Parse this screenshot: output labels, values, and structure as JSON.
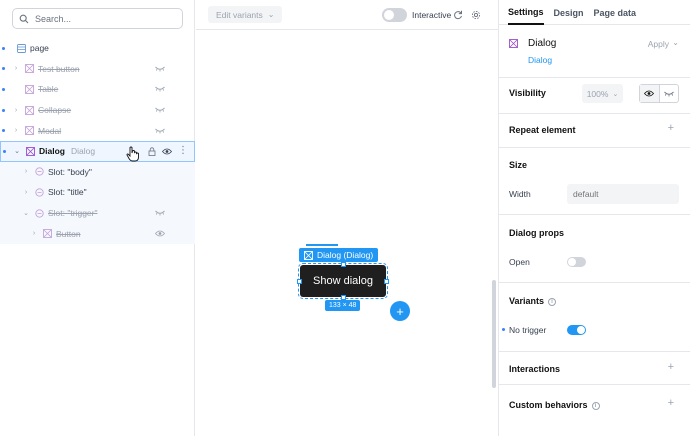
{
  "search": {
    "placeholder": "Search..."
  },
  "tree": {
    "page": "page",
    "items": [
      {
        "label": "Test button"
      },
      {
        "label": "Table"
      },
      {
        "label": "Collapse"
      },
      {
        "label": "Modal"
      }
    ],
    "dialog": {
      "label": "Dialog",
      "sub": "Dialog"
    },
    "slots": [
      {
        "label": "Slot: \"body\""
      },
      {
        "label": "Slot: \"title\""
      },
      {
        "label": "Slot: \"trigger\""
      }
    ],
    "button": {
      "label": "Button"
    }
  },
  "topbar": {
    "variants_label": "Edit variants",
    "interactive_label": "Interactive"
  },
  "canvas": {
    "component_tag": "Dialog (Dialog)",
    "button_text": "Show dialog",
    "size_label": "133 × 48",
    "add_symbol": "+"
  },
  "right": {
    "tabs": [
      "Settings",
      "Design",
      "Page data"
    ],
    "component_name": "Dialog",
    "component_link": "Dialog",
    "apply_label": "Apply",
    "visibility_label": "Visibility",
    "visibility_value": "100%",
    "repeat_label": "Repeat element",
    "size_title": "Size",
    "width_label": "Width",
    "width_placeholder": "default",
    "dialog_props_title": "Dialog props",
    "open_label": "Open",
    "variants_title": "Variants",
    "no_trigger_label": "No trigger",
    "interactions_label": "Interactions",
    "custom_behaviors_label": "Custom behaviors"
  },
  "colors": {
    "accent": "#2196f3",
    "dialog_button": "#1f1f1f"
  }
}
